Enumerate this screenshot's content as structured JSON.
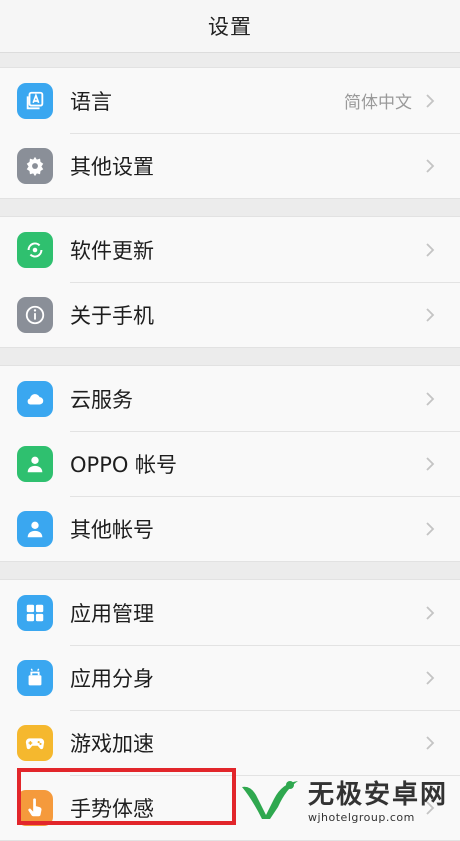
{
  "header": {
    "title": "设置"
  },
  "groups": [
    {
      "items": [
        {
          "label": "语言",
          "value": "简体中文",
          "icon": "language-icon",
          "color": "#3aa7f0"
        },
        {
          "label": "其他设置",
          "value": "",
          "icon": "gear-icon",
          "color": "#8a8f98"
        }
      ]
    },
    {
      "items": [
        {
          "label": "软件更新",
          "value": "",
          "icon": "update-icon",
          "color": "#2fc06f"
        },
        {
          "label": "关于手机",
          "value": "",
          "icon": "info-icon",
          "color": "#8a8f98"
        }
      ]
    },
    {
      "items": [
        {
          "label": "云服务",
          "value": "",
          "icon": "cloud-icon",
          "color": "#3aa7f0"
        },
        {
          "label": "OPPO 帐号",
          "value": "",
          "icon": "account-icon",
          "color": "#2fc06f"
        },
        {
          "label": "其他帐号",
          "value": "",
          "icon": "other-account-icon",
          "color": "#3aa7f0"
        }
      ]
    },
    {
      "items": [
        {
          "label": "应用管理",
          "value": "",
          "icon": "apps-grid-icon",
          "color": "#3aa7f0"
        },
        {
          "label": "应用分身",
          "value": "",
          "icon": "app-clone-icon",
          "color": "#3aa7f0"
        },
        {
          "label": "游戏加速",
          "value": "",
          "icon": "gamepad-icon",
          "color": "#f5b82e"
        },
        {
          "label": "手势体感",
          "value": "",
          "icon": "hand-gesture-icon",
          "color": "#f59a3c"
        }
      ]
    }
  ],
  "watermark": {
    "title": "无极安卓网",
    "url": "wjhotelgroup.com"
  }
}
